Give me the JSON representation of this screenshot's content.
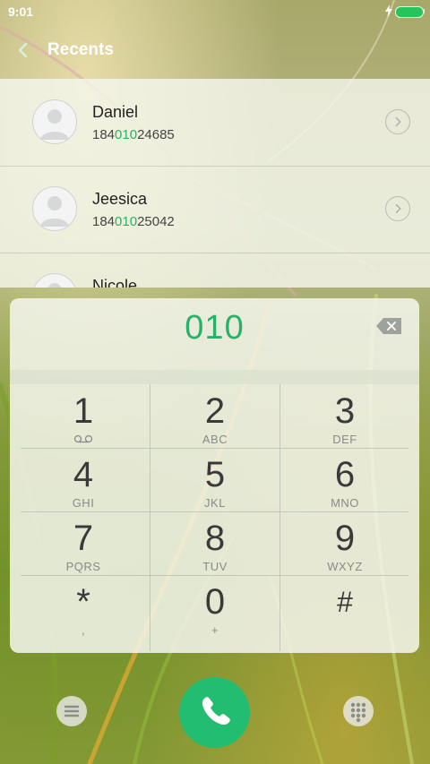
{
  "status_bar": {
    "time": "9:01"
  },
  "header": {
    "title": "Recents"
  },
  "recents": [
    {
      "name": "Daniel",
      "number_prefix": "184",
      "number_match": "010",
      "number_suffix": "24685"
    },
    {
      "name": "Jeesica",
      "number_prefix": "184",
      "number_match": "010",
      "number_suffix": "25042"
    },
    {
      "name": "Nicole",
      "number_prefix": "",
      "number_match": "",
      "number_suffix": ""
    }
  ],
  "dialpad": {
    "entered": "010",
    "keys": [
      {
        "digit": "1",
        "letters": ""
      },
      {
        "digit": "2",
        "letters": "ABC"
      },
      {
        "digit": "3",
        "letters": "DEF"
      },
      {
        "digit": "4",
        "letters": "GHI"
      },
      {
        "digit": "5",
        "letters": "JKL"
      },
      {
        "digit": "6",
        "letters": "MNO"
      },
      {
        "digit": "7",
        "letters": "PQRS"
      },
      {
        "digit": "8",
        "letters": "TUV"
      },
      {
        "digit": "9",
        "letters": "WXYZ"
      },
      {
        "digit": "*",
        "letters": ","
      },
      {
        "digit": "0",
        "letters": "+"
      },
      {
        "digit": "#",
        "letters": ""
      }
    ]
  },
  "colors": {
    "accent": "#27b26a",
    "call": "#22bd70"
  },
  "icons": {
    "back": "back-arrow-icon",
    "delete": "backspace-icon",
    "voicemail": "voicemail-icon",
    "menu": "menu-icon",
    "call": "phone-icon",
    "grid": "dialpad-grid-icon"
  }
}
